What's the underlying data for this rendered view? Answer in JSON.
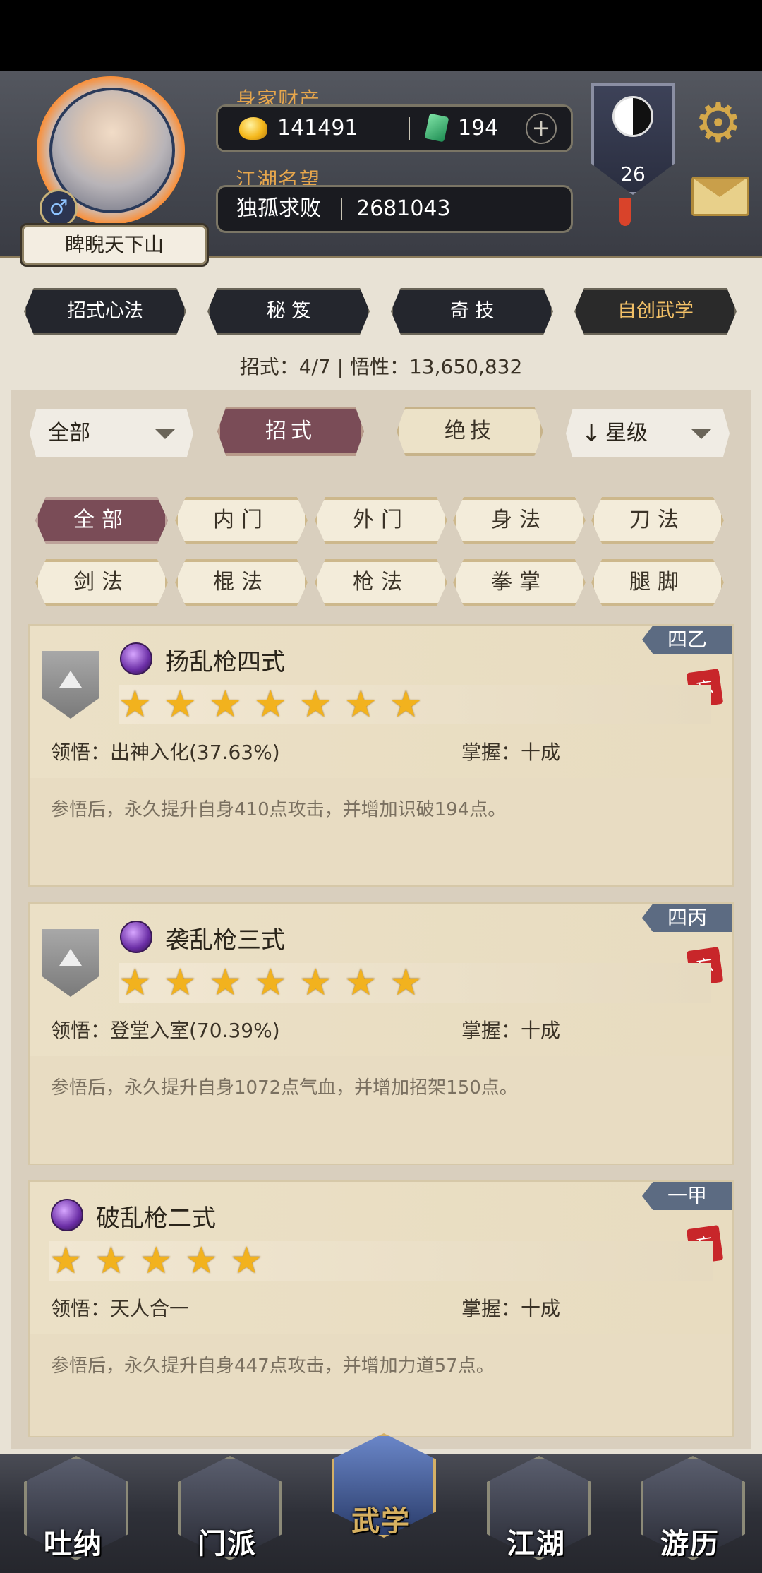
{
  "player": {
    "name": "睥睨天下山",
    "gender_icon": "male-icon",
    "wealth_label": "身家财产",
    "gold": "141491",
    "jade": "194",
    "fame_label": "江湖名望",
    "title": "独孤求败",
    "fame": "2681043",
    "level": "26"
  },
  "tabs": [
    "招式心法",
    "秘 笈",
    "奇 技",
    "自创武学"
  ],
  "summary": "招式：4/7 | 悟性：13,650,832",
  "filters": {
    "category_dropdown": "全部",
    "seg_moves": "招式",
    "seg_ultimate": "绝技",
    "sort_dropdown": "星级"
  },
  "chips": [
    "全部",
    "内门",
    "外门",
    "身法",
    "刀法",
    "剑法",
    "棍法",
    "枪法",
    "拳掌",
    "腿脚"
  ],
  "cards": [
    {
      "tier": "四乙",
      "seal": "忘",
      "title": "扬乱枪四式",
      "stars": 7,
      "insight": "领悟：出神入化(37.63%)",
      "mastery": "掌握：十成",
      "desc": "参悟后，永久提升自身410点攻击，并增加识破194点。"
    },
    {
      "tier": "四丙",
      "seal": "忘",
      "title": "袭乱枪三式",
      "stars": 7,
      "insight": "领悟：登堂入室(70.39%)",
      "mastery": "掌握：十成",
      "desc": "参悟后，永久提升自身1072点气血，并增加招架150点。"
    },
    {
      "tier": "一甲",
      "seal": "忘",
      "title": "破乱枪二式",
      "stars": 5,
      "insight": "领悟：天人合一",
      "mastery": "掌握：十成",
      "desc": "参悟后，永久提升自身447点攻击，并增加力道57点。"
    }
  ],
  "bottom_nav": [
    "吐纳",
    "门派",
    "武学",
    "江湖",
    "游历"
  ],
  "colors": {
    "accent_active": "#7a4c57",
    "tier_tag": "#5c6b82",
    "star": "#f2b21e",
    "gold_label": "#e6a64c"
  }
}
